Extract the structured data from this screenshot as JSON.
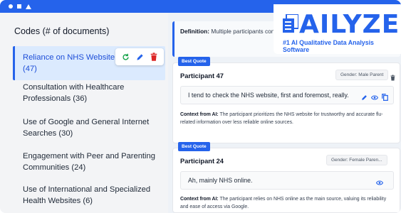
{
  "sidebar": {
    "title": "Codes (# of documents)",
    "items": [
      {
        "label": "Reliance on NHS Website as Source (47)"
      },
      {
        "label": "Consultation with Healthcare Professionals (36)"
      },
      {
        "label": "Use of Google and General Internet Searches (30)"
      },
      {
        "label": "Engagement with Peer and Parenting Communities (24)"
      },
      {
        "label": "Use of International and Specialized Health Websites (6)"
      }
    ]
  },
  "definition": {
    "label": "Definition:",
    "text": "Multiple participants consi... primary, trusted source for accurate a..."
  },
  "quotes": [
    {
      "badge": "Best Quote",
      "participant": "Participant 47",
      "gender": "Gender: Male Parent",
      "quote": "I tend to check the NHS website, first and foremost, really.",
      "context_label": "Context from AI:",
      "context": "The participant prioritizes the NHS website for trustworthy and accurate flu-related information over less reliable online sources."
    },
    {
      "badge": "Best Quote",
      "participant": "Participant 24",
      "gender": "Gender: Female Paren...",
      "quote": "Ah, mainly NHS online.",
      "context_label": "Context from AI:",
      "context": "The participant relies on NHS online as the main source, valuing its reliability and ease of access via Google."
    }
  ],
  "logo": {
    "wordmark": "AILYZE",
    "tagline": "#1 AI Qualitative Data Analysis Software"
  },
  "colors": {
    "accent": "#2563eb",
    "active_bg": "#dbeafe",
    "refresh": "#16a34a",
    "delete": "#dc2626"
  }
}
